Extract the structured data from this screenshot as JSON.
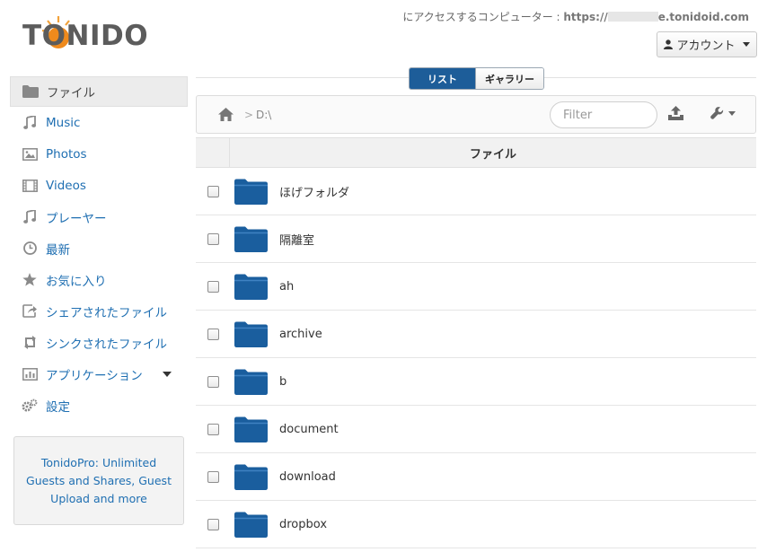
{
  "logo": {
    "text": "TONIDO"
  },
  "header": {
    "access_label": "にアクセスするコンピューター : ",
    "url_prefix": "https://",
    "url_suffix": "e.tonidoid.com",
    "account_label": "アカウント"
  },
  "sidebar": {
    "items": [
      {
        "label": "ファイル",
        "icon": "folder-icon",
        "active": true
      },
      {
        "label": "Music",
        "icon": "music-icon"
      },
      {
        "label": "Photos",
        "icon": "photo-icon"
      },
      {
        "label": "Videos",
        "icon": "film-icon"
      },
      {
        "label": "プレーヤー",
        "icon": "music-icon"
      },
      {
        "label": "最新",
        "icon": "clock-icon"
      },
      {
        "label": "お気に入り",
        "icon": "star-icon"
      },
      {
        "label": "シェアされたファイル",
        "icon": "share-icon"
      },
      {
        "label": "シンクされたファイル",
        "icon": "sync-icon"
      },
      {
        "label": "アプリケーション",
        "icon": "chart-icon"
      },
      {
        "label": "設定",
        "icon": "gears-icon"
      }
    ],
    "promo": "TonidoPro: Unlimited Guests and Shares, Guest Upload and more"
  },
  "view_toggle": {
    "list": "リスト",
    "gallery": "ギャラリー"
  },
  "toolbar": {
    "path": "D:\\",
    "separator": ">",
    "filter_placeholder": "Filter"
  },
  "table": {
    "header": "ファイル",
    "rows": [
      "ほげフォルダ",
      "隔離室",
      "ah",
      "archive",
      "b",
      "document",
      "download",
      "dropbox"
    ]
  },
  "colors": {
    "accent": "#1d5d99",
    "link": "#1f6fb2",
    "folder": "#1a5e9e"
  }
}
